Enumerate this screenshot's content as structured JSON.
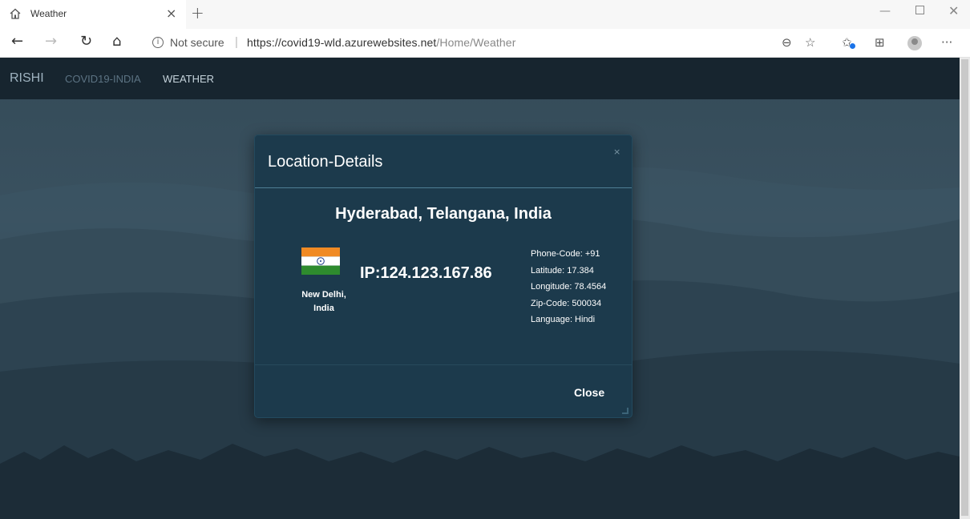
{
  "browser": {
    "tab": {
      "title": "Weather",
      "favicon": "home-page-icon",
      "close_glyph": "×"
    },
    "new_tab_glyph": "+",
    "window_controls": {
      "minimize": "—",
      "close": "✕"
    },
    "nav_glyphs": {
      "back": "←",
      "forward": "→",
      "refresh": "↻",
      "home": "⌂"
    },
    "security_label": "Not secure",
    "separator": "|",
    "url": {
      "host": "https://covid19-wld.azurewebsites.net",
      "path": "/Home/Weather"
    },
    "toolbar_glyphs": {
      "zoom": "⊖",
      "favorite": "☆",
      "favorites": "✩",
      "collections": "⊞",
      "more": "···"
    }
  },
  "site": {
    "brand": "RISHI",
    "nav": [
      {
        "label": "COVID19-INDIA"
      },
      {
        "label": "WEATHER"
      }
    ]
  },
  "modal": {
    "title": "Location-Details",
    "close_x": "×",
    "location": "Hyderabad, Telangana, India",
    "ip": "IP:124.123.167.86",
    "capital_line1": "New Delhi,",
    "capital_line2": "India",
    "details": {
      "phone_code": "Phone-Code: +91",
      "latitude": "Latitude: 17.384",
      "longitude": "Longitude: 78.4564",
      "zip_code": "Zip-Code: 500034",
      "language": "Language: Hindi"
    },
    "close_button": "Close"
  },
  "colors": {
    "navbar": "#17252f",
    "modal_bg": "#1c3a4c",
    "flag_saffron": "#f08a24",
    "flag_white": "#ffffff",
    "flag_green": "#2e8b2e",
    "chakra": "#1f3c8a"
  }
}
